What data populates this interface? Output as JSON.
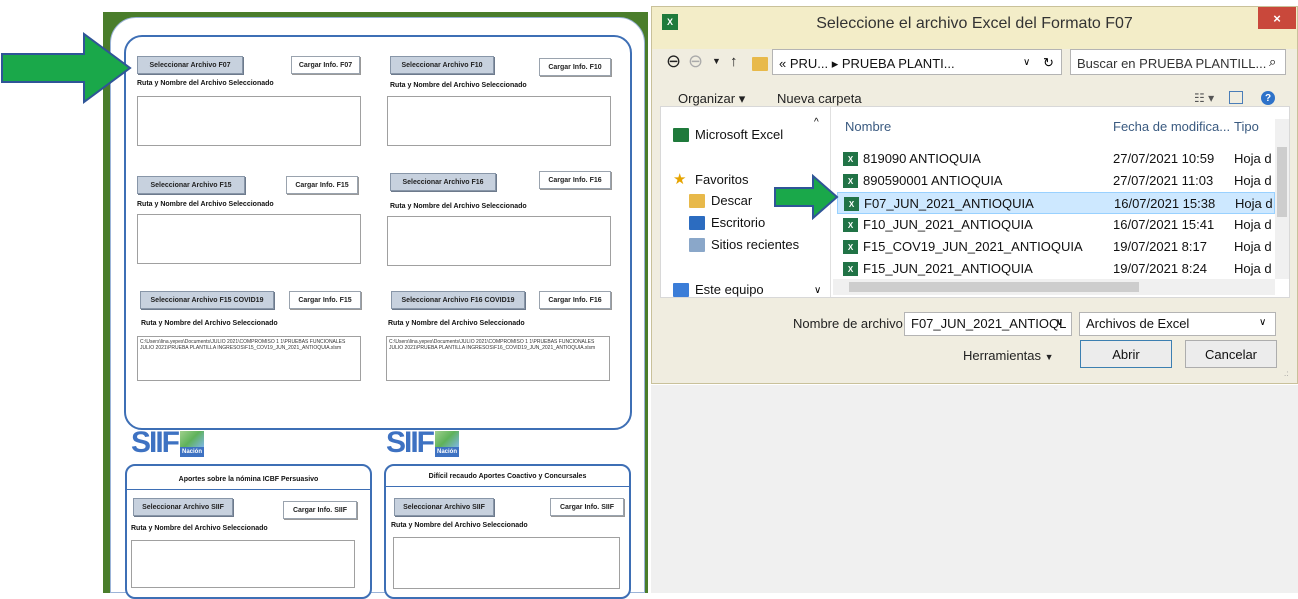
{
  "form": {
    "sections": [
      {
        "select_label": "Seleccionar Archivo F07",
        "load_label": "Cargar Info. F07",
        "path_label": "Ruta y Nombre del Archivo Seleccionado",
        "path_value": ""
      },
      {
        "select_label": "Seleccionar Archivo F10",
        "load_label": "Cargar Info. F10",
        "path_label": "Ruta y Nombre del Archivo Seleccionado",
        "path_value": ""
      },
      {
        "select_label": "Seleccionar Archivo F15",
        "load_label": "Cargar Info. F15",
        "path_label": "Ruta y Nombre del Archivo Seleccionado",
        "path_value": ""
      },
      {
        "select_label": "Seleccionar Archivo F16",
        "load_label": "Cargar Info. F16",
        "path_label": "Ruta y Nombre del Archivo Seleccionado",
        "path_value": ""
      },
      {
        "select_label": "Seleccionar Archivo F15 COVID19",
        "load_label": "Cargar Info. F15",
        "path_label": "Ruta y Nombre del Archivo Seleccionado",
        "path_value": "C:\\Users\\lina.yepes\\Documents\\JULIO 2021\\COMPROMISO 1 1\\PRUEBAS FUNCIONALES JULIO 2021\\PRUEBA PLANTILLA INGRESOS\\F15_COV19_JUN_2021_ANTIOQUIA.xlsm"
      },
      {
        "select_label": "Seleccionar Archivo F16 COVID19",
        "load_label": "Cargar Info. F16",
        "path_label": "Ruta y Nombre del Archivo Seleccionado",
        "path_value": "C:\\Users\\lina.yepes\\Documents\\JULIO 2021\\COMPROMISO 1 1\\PRUEBAS FUNCIONALES JULIO 2021\\PRUEBA PLANTILLA INGRESOS\\F16_COVID19_JUN_2021_ANTIOQUIA.xlsm"
      }
    ],
    "siif": {
      "brand": "SIIF",
      "brand_sub": "Nación"
    },
    "bottom_sections": [
      {
        "title": "Aportes sobre la nómina ICBF Persuasivo",
        "select_label": "Seleccionar Archivo SIIF",
        "load_label": "Cargar Info. SIIF",
        "path_label": "Ruta y Nombre del Archivo Seleccionado"
      },
      {
        "title": "Difícil recaudo Aportes Coactivo y Concursales",
        "select_label": "Seleccionar Archivo SIIF",
        "load_label": "Cargar Info. SIIF",
        "path_label": "Ruta y Nombre del Archivo Seleccionado"
      }
    ]
  },
  "dialog": {
    "title": "Seleccione el archivo Excel del Formato F07",
    "close": "×",
    "breadcrumb": "«  PRU...  ▸  PRUEBA PLANTI...",
    "search_placeholder": "Buscar en PRUEBA PLANTILL...",
    "organize": "Organizar ▾",
    "new_folder": "Nueva carpeta",
    "nav_items": [
      "Microsoft Excel",
      "Favoritos",
      "Descar",
      "Escritorio",
      "Sitios recientes",
      "Este equipo"
    ],
    "columns": {
      "name": "Nombre",
      "date": "Fecha de modifica...",
      "type": "Tipo"
    },
    "files": [
      {
        "name": "819090 ANTIOQUIA",
        "date": "27/07/2021 10:59",
        "type": "Hoja d",
        "selected": false
      },
      {
        "name": "890590001 ANTIOQUIA",
        "date": "27/07/2021 11:03",
        "type": "Hoja d",
        "selected": false
      },
      {
        "name": "F07_JUN_2021_ANTIOQUIA",
        "date": "16/07/2021 15:38",
        "type": "Hoja d",
        "selected": true
      },
      {
        "name": "F10_JUN_2021_ANTIOQUIA",
        "date": "16/07/2021 15:41",
        "type": "Hoja d",
        "selected": false
      },
      {
        "name": "F15_COV19_JUN_2021_ANTIOQUIA",
        "date": "19/07/2021 8:17",
        "type": "Hoja d",
        "selected": false
      },
      {
        "name": "F15_JUN_2021_ANTIOQUIA",
        "date": "19/07/2021 8:24",
        "type": "Hoja d",
        "selected": false
      }
    ],
    "filename_label": "Nombre de archivo:",
    "filename_value": "F07_JUN_2021_ANTIOQL",
    "filter_value": "Archivos de Excel",
    "tools_label": "Herramientas",
    "open_label": "Abrir",
    "cancel_label": "Cancelar"
  },
  "colors": {
    "arrow": "#1aa84a",
    "arrow_border": "#2f5597",
    "group_border": "#3e6fb5",
    "selected_row": "#cde8ff",
    "title_bar": "#f3edc8"
  }
}
